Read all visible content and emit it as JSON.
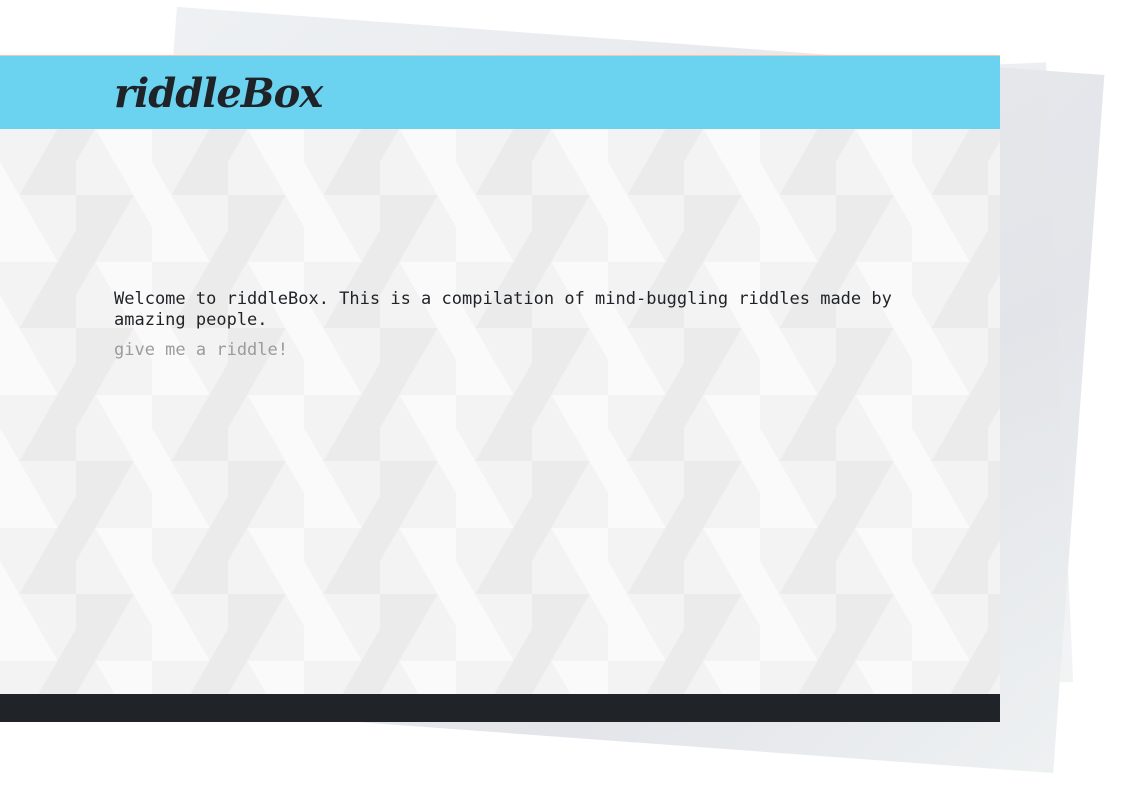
{
  "brand": {
    "logo_text": "riddleBox"
  },
  "main": {
    "welcome_text": "Welcome to riddleBox. This is a compilation of mind-buggling riddles made by amazing people.",
    "riddle_link_label": "give me a riddle!"
  },
  "colors": {
    "header_bg": "#6bd2f0",
    "footer_bg": "#202327",
    "text_primary": "#1f2226",
    "link_muted": "#9b9b9b"
  }
}
